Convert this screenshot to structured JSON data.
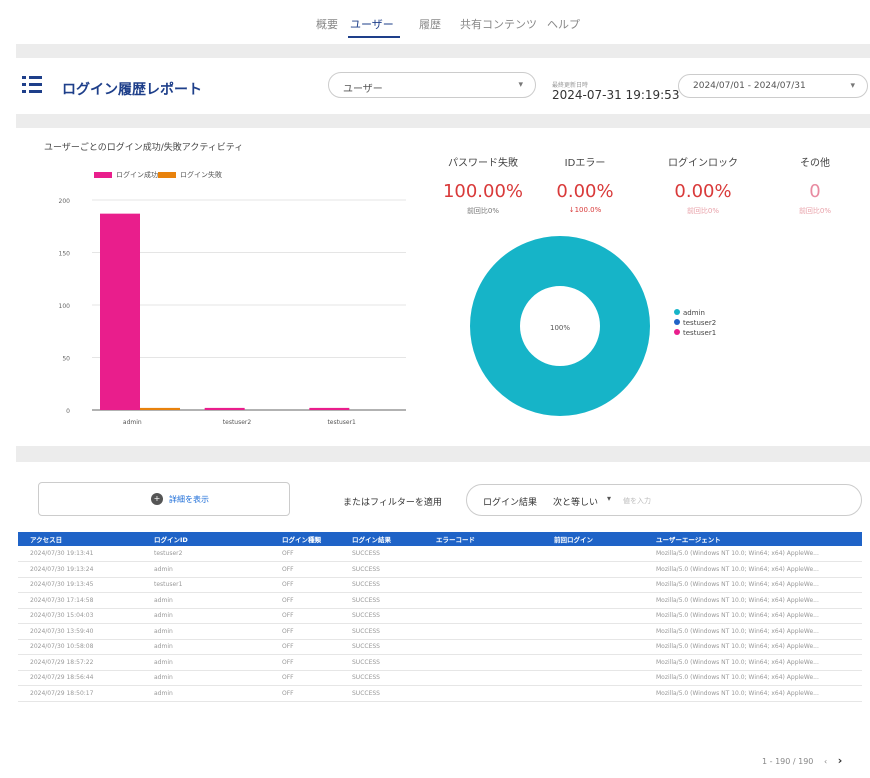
{
  "nav": {
    "tabs": [
      {
        "label": "概要",
        "active": false
      },
      {
        "label": "ユーザー",
        "active": true
      },
      {
        "label": "履歴",
        "active": false
      },
      {
        "label": "共有コンテンツ",
        "active": false
      },
      {
        "label": "ヘルプ",
        "active": false
      }
    ]
  },
  "header": {
    "title": "ログイン履歴レポート",
    "user_select": "ユーザー",
    "updated_label": "最終更新日時",
    "updated_value": "2024-07-31 19:19:53",
    "date_range": "2024/07/01 - 2024/07/31"
  },
  "chart_data": {
    "type": "bar",
    "title": "ユーザーごとのログイン成功/失敗アクティビティ",
    "categories": [
      "admin",
      "testuser2",
      "testuser1"
    ],
    "series": [
      {
        "name": "ログイン成功",
        "values": [
          187,
          2,
          2
        ],
        "color": "#e91e8c"
      },
      {
        "name": "ログイン失敗",
        "values": [
          2,
          0,
          0
        ],
        "color": "#e8820c"
      }
    ],
    "yticks": [
      0,
      50,
      100,
      150,
      200
    ],
    "ylim": [
      0,
      200
    ]
  },
  "metrics": [
    {
      "label": "パスワード失敗",
      "value": "100.00%",
      "sub": "前回比0%",
      "color": "#d93a3a",
      "sub_color": "#777"
    },
    {
      "label": "IDエラー",
      "value": "0.00%",
      "sub": "↓100.0%",
      "color": "#d93a3a",
      "sub_color": "#d93a3a"
    },
    {
      "label": "ログインロック",
      "value": "0.00%",
      "sub": "前回比0%",
      "color": "#d93a3a",
      "sub_color": "#e8a0a8"
    },
    {
      "label": "その他",
      "value": "0",
      "sub": "前回比0%",
      "color": "#e88aa0",
      "sub_color": "#e8a0a8"
    }
  ],
  "donut": {
    "center_label": "100%",
    "slices": [
      {
        "name": "admin",
        "value": 100,
        "color": "#16b4c8"
      },
      {
        "name": "testuser2",
        "value": 0,
        "color": "#1f63c7"
      },
      {
        "name": "testuser1",
        "value": 0,
        "color": "#e91e8c"
      }
    ]
  },
  "filters": {
    "detail_button": "詳細を表示",
    "hint": "またはフィルターを適用",
    "field": "ログイン結果",
    "operator": "次と等しい",
    "placeholder": "値を入力"
  },
  "table": {
    "columns": [
      "アクセス日",
      "ログインID",
      "ログイン種類",
      "ログイン結果",
      "エラーコード",
      "前回ログイン",
      "ユーザーエージェント"
    ],
    "rows": [
      [
        "2024/07/30 19:13:41",
        "testuser2",
        "OFF",
        "SUCCESS",
        "",
        "",
        "Mozilla/5.0 (Windows NT 10.0; Win64; x64) AppleWe..."
      ],
      [
        "2024/07/30 19:13:24",
        "admin",
        "OFF",
        "SUCCESS",
        "",
        "",
        "Mozilla/5.0 (Windows NT 10.0; Win64; x64) AppleWe..."
      ],
      [
        "2024/07/30 19:13:45",
        "testuser1",
        "OFF",
        "SUCCESS",
        "",
        "",
        "Mozilla/5.0 (Windows NT 10.0; Win64; x64) AppleWe..."
      ],
      [
        "2024/07/30 17:14:58",
        "admin",
        "OFF",
        "SUCCESS",
        "",
        "",
        "Mozilla/5.0 (Windows NT 10.0; Win64; x64) AppleWe..."
      ],
      [
        "2024/07/30 15:04:03",
        "admin",
        "OFF",
        "SUCCESS",
        "",
        "",
        "Mozilla/5.0 (Windows NT 10.0; Win64; x64) AppleWe..."
      ],
      [
        "2024/07/30 13:59:40",
        "admin",
        "OFF",
        "SUCCESS",
        "",
        "",
        "Mozilla/5.0 (Windows NT 10.0; Win64; x64) AppleWe..."
      ],
      [
        "2024/07/30 10:58:08",
        "admin",
        "OFF",
        "SUCCESS",
        "",
        "",
        "Mozilla/5.0 (Windows NT 10.0; Win64; x64) AppleWe..."
      ],
      [
        "2024/07/29 18:57:22",
        "admin",
        "OFF",
        "SUCCESS",
        "",
        "",
        "Mozilla/5.0 (Windows NT 10.0; Win64; x64) AppleWe..."
      ],
      [
        "2024/07/29 18:56:44",
        "admin",
        "OFF",
        "SUCCESS",
        "",
        "",
        "Mozilla/5.0 (Windows NT 10.0; Win64; x64) AppleWe..."
      ],
      [
        "2024/07/29 18:50:17",
        "admin",
        "OFF",
        "SUCCESS",
        "",
        "",
        "Mozilla/5.0 (Windows NT 10.0; Win64; x64) AppleWe..."
      ]
    ],
    "pagination": "1 - 190 / 190"
  },
  "colors": {
    "brand": "#1e3f8a",
    "table_header": "#1f63c7"
  }
}
